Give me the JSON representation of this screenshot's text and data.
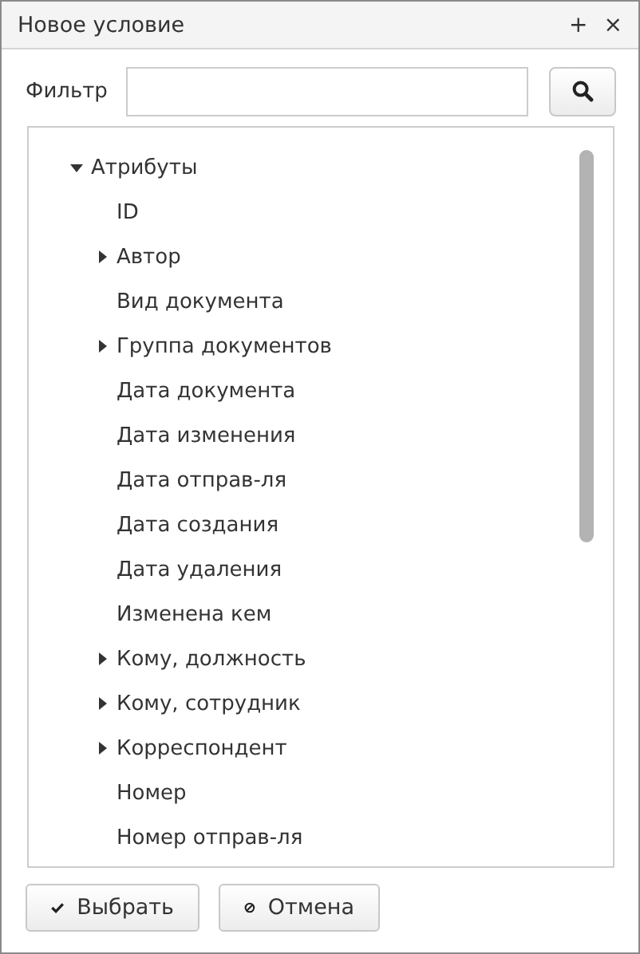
{
  "window": {
    "title": "Новое условие",
    "buttons": [
      "+",
      "×"
    ]
  },
  "filter": {
    "label": "Фильтр"
  },
  "tree": [
    {
      "label": "Атрибуты",
      "kind": "group",
      "expanded": true,
      "children": [
        {
          "label": "ID",
          "kind": "leaf"
        },
        {
          "label": "Автор",
          "kind": "group",
          "expanded": false
        },
        {
          "label": "Вид документа",
          "kind": "leaf"
        },
        {
          "label": "Группа документов",
          "kind": "group",
          "expanded": false
        },
        {
          "label": "Дата документа",
          "kind": "leaf"
        },
        {
          "label": "Дата изменения",
          "kind": "leaf"
        },
        {
          "label": "Дата отправ-ля",
          "kind": "leaf"
        },
        {
          "label": "Дата создания",
          "kind": "leaf"
        },
        {
          "label": "Дата удаления",
          "kind": "leaf"
        },
        {
          "label": "Изменена кем",
          "kind": "leaf"
        },
        {
          "label": "Кому, должность",
          "kind": "group",
          "expanded": false
        },
        {
          "label": "Кому, сотрудник",
          "kind": "group",
          "expanded": false
        },
        {
          "label": "Корреспондент",
          "kind": "group",
          "expanded": false
        },
        {
          "label": "Номер",
          "kind": "leaf"
        },
        {
          "label": "Номер отправ-ля",
          "kind": "leaf"
        }
      ]
    }
  ],
  "buttons": [
    {
      "label": "Выбрать",
      "kind": "ok"
    },
    {
      "label": "Отмена",
      "kind": "cancel"
    }
  ]
}
